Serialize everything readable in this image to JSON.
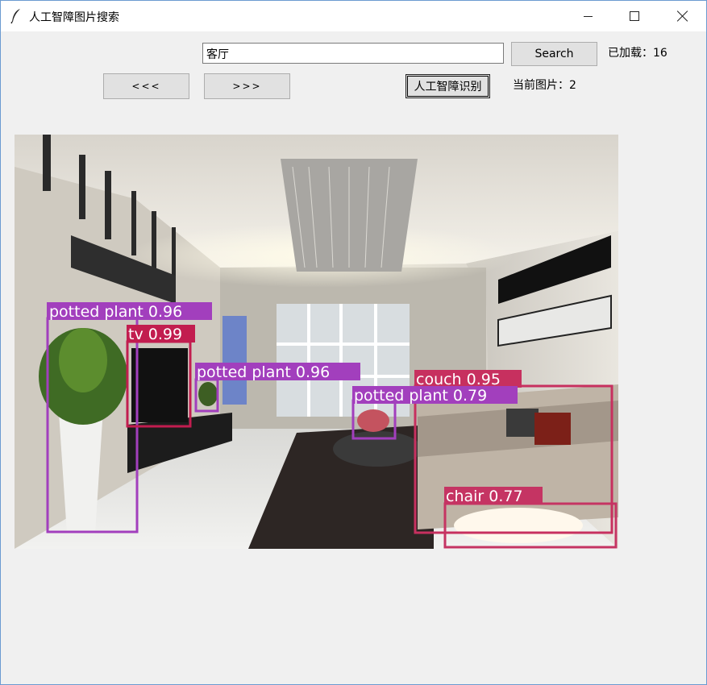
{
  "window": {
    "title": "人工智障图片搜索"
  },
  "titlebar_icons": {
    "app": "feather-icon",
    "minimize": "minimize-icon",
    "maximize": "maximize-icon",
    "close": "close-icon"
  },
  "search": {
    "value": "客厅",
    "button_label": "Search"
  },
  "status": {
    "loaded_label": "已加载：16",
    "current_label": "当前图片：2"
  },
  "nav": {
    "prev_label": "<<<",
    "next_label": ">>>"
  },
  "ai_button_label": "人工智障识别",
  "detections": [
    {
      "label": "potted plant 0.96",
      "color": "#a23fbd"
    },
    {
      "label": "tv 0.99",
      "color": "#c21d4f"
    },
    {
      "label": "potted plant 0.96",
      "color": "#a23fbd"
    },
    {
      "label": "couch 0.95",
      "color": "#c7305f"
    },
    {
      "label": "potted plant 0.79",
      "color": "#a23fbd"
    },
    {
      "label": "chair 0.77",
      "color": "#c53463"
    }
  ]
}
